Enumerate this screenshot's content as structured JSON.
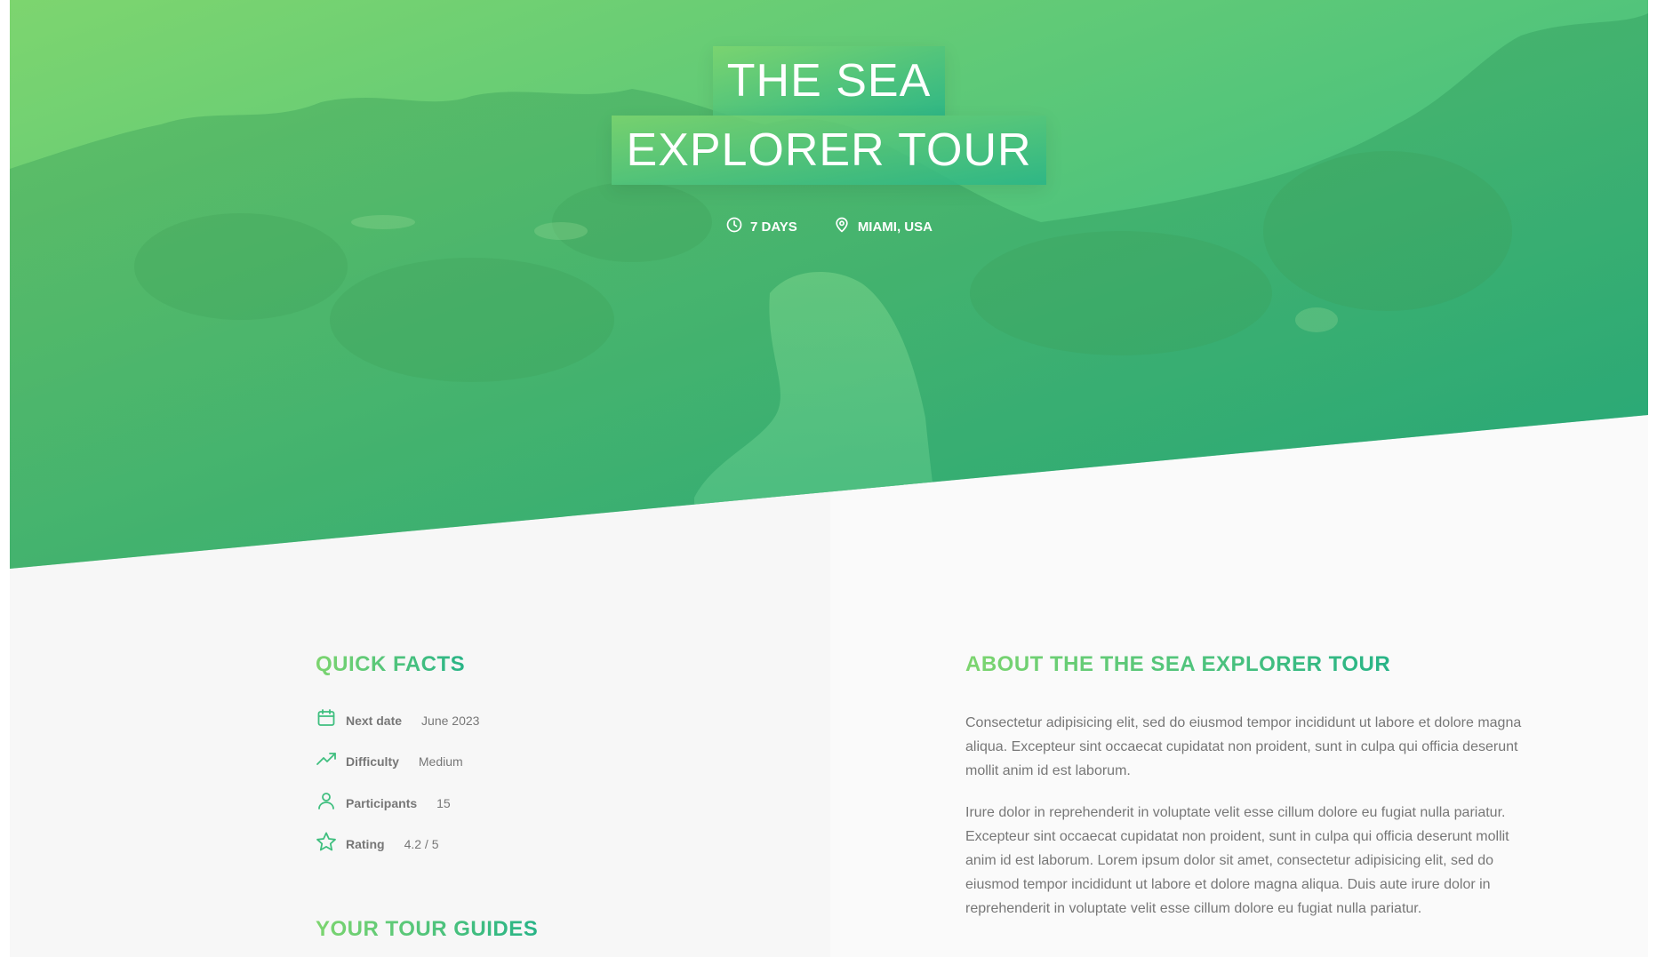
{
  "hero": {
    "title_line1": "THE SEA",
    "title_line2": "EXPLORER TOUR",
    "duration": "7 DAYS",
    "location": "MIAMI, USA",
    "icons": [
      "clock-icon",
      "map-pin-icon"
    ]
  },
  "quick_facts": {
    "heading": "QUICK FACTS",
    "items": [
      {
        "icon": "calendar-icon",
        "label": "Next date",
        "value": "June 2023"
      },
      {
        "icon": "trending-up-icon",
        "label": "Difficulty",
        "value": "Medium"
      },
      {
        "icon": "user-icon",
        "label": "Participants",
        "value": "15"
      },
      {
        "icon": "star-icon",
        "label": "Rating",
        "value": "4.2 / 5"
      }
    ]
  },
  "guides": {
    "heading": "YOUR TOUR GUIDES"
  },
  "about": {
    "heading": "ABOUT THE THE SEA EXPLORER TOUR",
    "paragraphs": [
      "Consectetur adipisicing elit, sed do eiusmod tempor incididunt ut labore et dolore magna aliqua. Excepteur sint occaecat cupidatat non proident, sunt in culpa qui officia deserunt mollit anim id est laborum.",
      "Irure dolor in reprehenderit in voluptate velit esse cillum dolore eu fugiat nulla pariatur. Excepteur sint occaecat cupidatat non proident, sunt in culpa qui officia deserunt mollit anim id est laborum. Lorem ipsum dolor sit amet, consectetur adipisicing elit, sed do eiusmod tempor incididunt ut labore et dolore magna aliqua. Duis aute irure dolor in reprehenderit in voluptate velit esse cillum dolore eu fugiat nulla pariatur."
    ]
  },
  "colors": {
    "gradient_start": "#7dd56f",
    "gradient_end": "#28b487",
    "text": "#777777"
  }
}
